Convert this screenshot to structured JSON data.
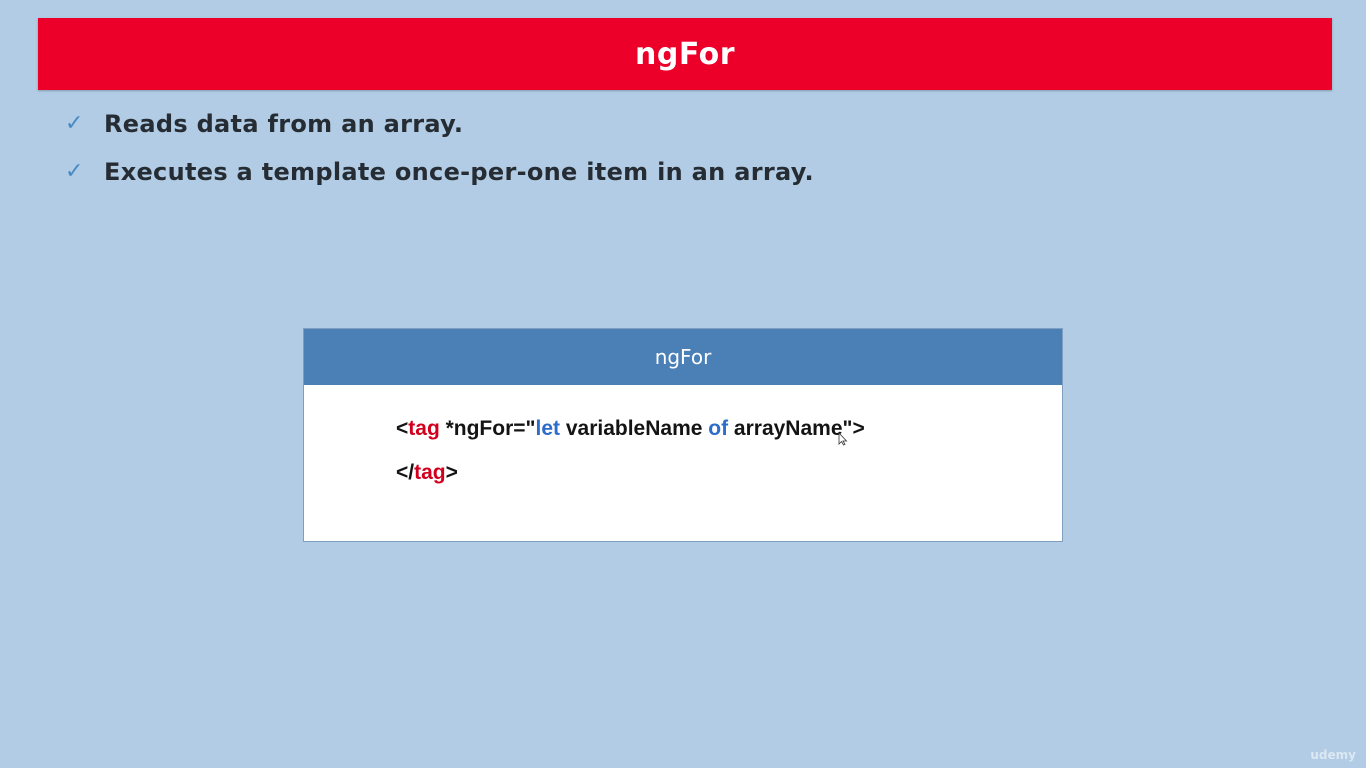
{
  "slide": {
    "title": "ngFor",
    "bullets": [
      {
        "icon": "check-icon",
        "text": "Reads data from an array."
      },
      {
        "icon": "check-icon",
        "text": "Executes a template once-per-one item in an array."
      }
    ]
  },
  "code_box": {
    "title": "ngFor",
    "line1": {
      "open": "<",
      "tag": "tag",
      "directive": " *ngFor=\"",
      "let": "let",
      "variable": " variableName ",
      "of": "of",
      "array": " arrayName\">"
    },
    "line2": {
      "open": "</",
      "tag": "tag",
      "close": ">"
    }
  },
  "colors": {
    "background": "#b1cce4",
    "title_bar": "#ec0029",
    "code_header": "#4b80b6",
    "tag_red": "#d2001e",
    "keyword_blue": "#2e6cc9",
    "check_blue": "#4a8ac2"
  },
  "watermark": "udemy"
}
